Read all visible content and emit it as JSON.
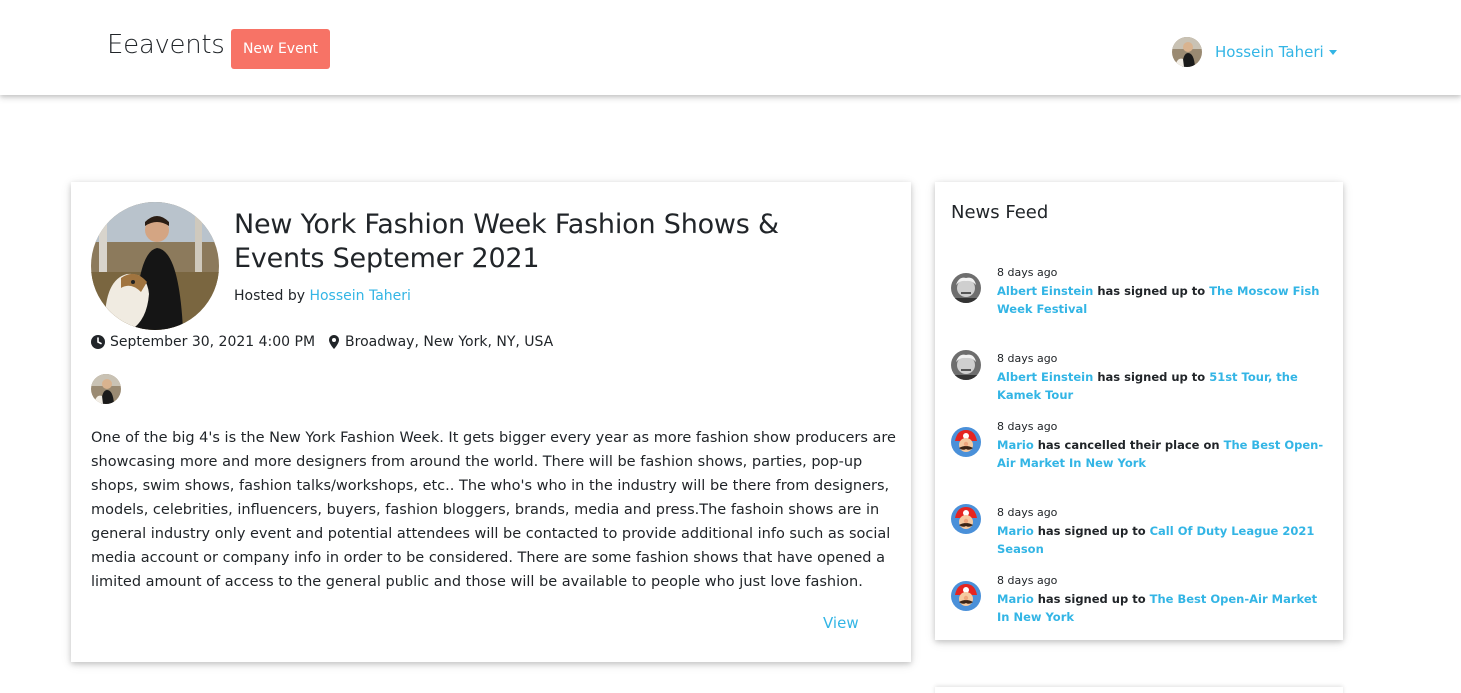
{
  "navbar": {
    "brand": "Eeavents",
    "new_event_label": "New Event",
    "user_name": "Hossein Taheri"
  },
  "event": {
    "title": "New York Fashion Week Fashion Shows & Events Septemer 2021",
    "hosted_by_prefix": "Hosted by",
    "host_name": "Hossein Taheri",
    "date": "September 30, 2021 4:00 PM",
    "location": "Broadway, New York, NY, USA",
    "description": "One of the big 4's is the New York Fashion Week. It gets bigger every year as more fashion show producers are showcasing more and more designers from around the world. There will be fashion shows, parties, pop-up shops, swim shows, fashion talks/workshops, etc.. The who's who in the industry will be there from designers, models, celebrities, influencers, buyers, fashion bloggers, brands, media and press.The fashoin shows are in general industry only event and potential attendees will be contacted to provide additional info such as social media account or company info in order to be considered. There are some fashion shows that have opened a limited amount of access to the general public and those will be available to people who just love fashion.",
    "view_label": "View"
  },
  "news_feed": {
    "title": "News Feed",
    "items": [
      {
        "time": "8 days ago",
        "user": "Albert Einstein",
        "action": "has signed up to",
        "event": "The Moscow Fish Week Festival",
        "avatar": "einstein"
      },
      {
        "time": "8 days ago",
        "user": "Albert Einstein",
        "action": "has signed up to",
        "event": "51st Tour, the Kamek Tour",
        "avatar": "einstein"
      },
      {
        "time": "8 days ago",
        "user": "Mario",
        "action": "has cancelled their place on",
        "event": "The Best Open-Air Market In New York",
        "avatar": "mario"
      },
      {
        "time": "8 days ago",
        "user": "Mario",
        "action": "has signed up to",
        "event": "Call Of Duty League 2021 Season",
        "avatar": "mario"
      },
      {
        "time": "8 days ago",
        "user": "Mario",
        "action": "has signed up to",
        "event": "The Best Open-Air Market In New York",
        "avatar": "mario"
      }
    ]
  },
  "colors": {
    "accent_link": "#33b5e5",
    "new_event_button": "#f77366"
  }
}
